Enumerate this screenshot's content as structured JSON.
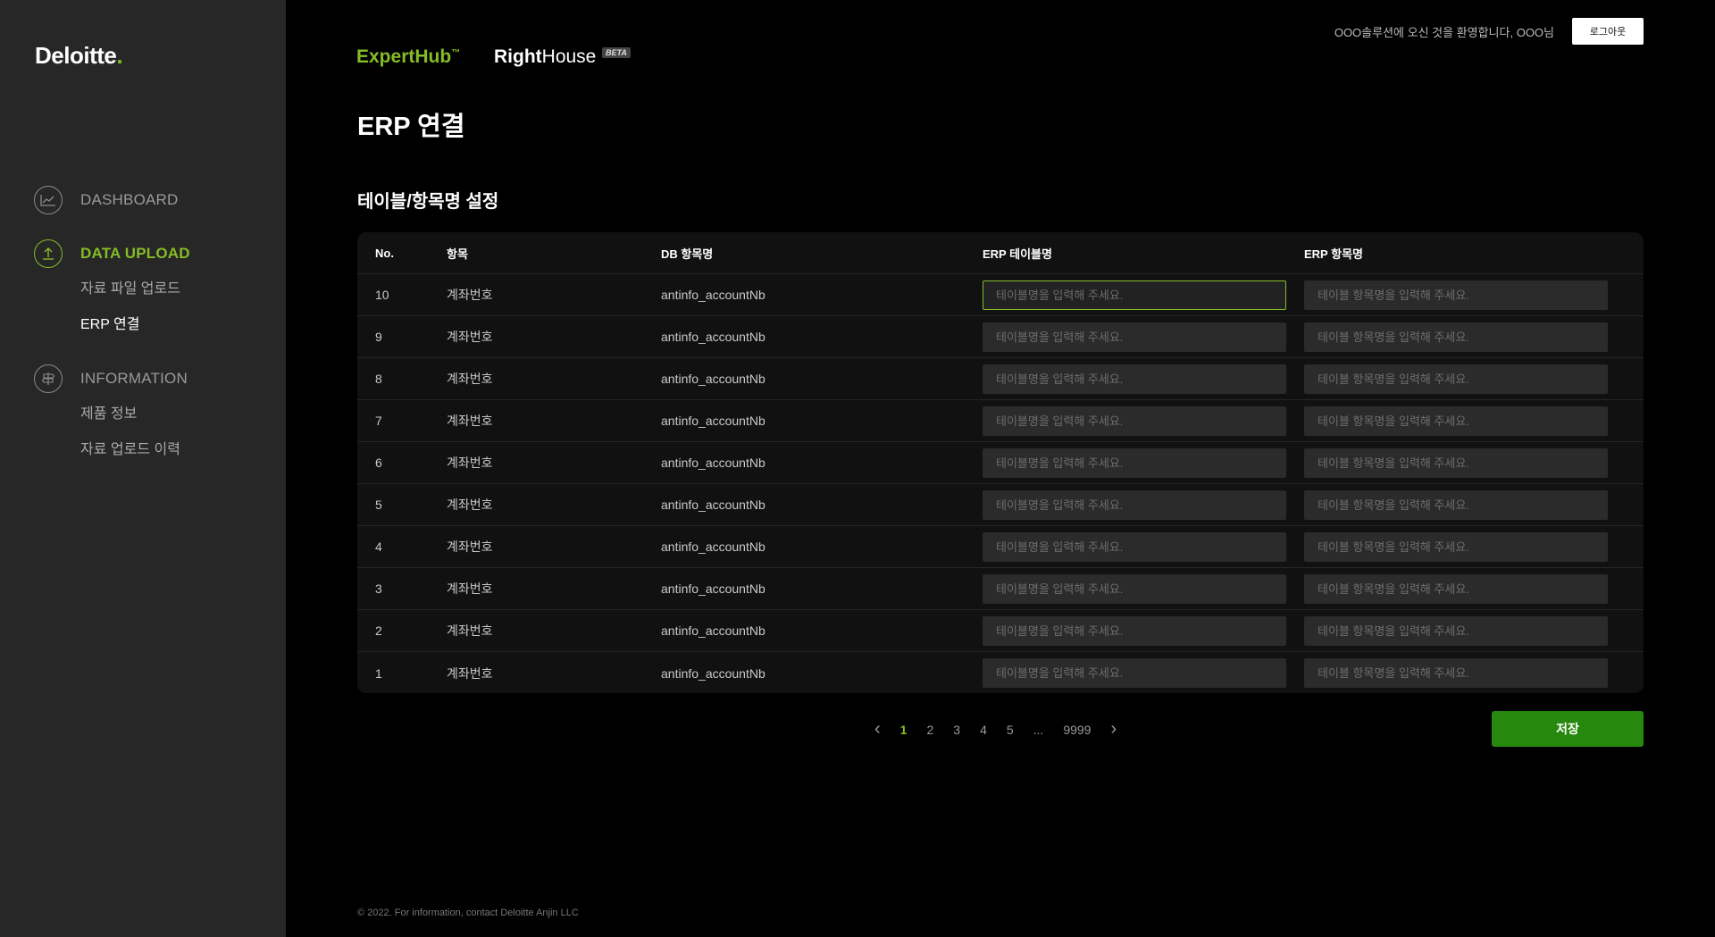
{
  "sidebar": {
    "logo_text": "Deloitte",
    "logo_dot": ".",
    "sections": [
      {
        "label": "DASHBOARD",
        "icon": "chart-line-icon",
        "active": false,
        "items": []
      },
      {
        "label": "DATA UPLOAD",
        "icon": "upload-icon",
        "active": true,
        "items": [
          "자료 파일 업로드",
          "ERP 연결"
        ]
      },
      {
        "label": "INFORMATION",
        "icon": "signpost-icon",
        "active": false,
        "items": [
          "제품 정보",
          "자료 업로드 이력"
        ]
      }
    ]
  },
  "header": {
    "brand1": "ExpertHub",
    "brand1_tm": "™",
    "brand2_bold": "Right",
    "brand2_light": "House",
    "beta": "BETA",
    "welcome": "OOO솔루션에 오신 것을 환영합니다, OOO님",
    "logout": "로그아웃"
  },
  "main": {
    "page_title": "ERP 연결",
    "section_title": "테이블/항목명 설정"
  },
  "table": {
    "headers": [
      "No.",
      "항목",
      "DB 항목명",
      "ERP 테이블명",
      "ERP 항목명"
    ],
    "placeholder_table": "테이블명을 입력해 주세요.",
    "placeholder_item": "테이블 항목명을 입력해 주세요.",
    "rows": [
      {
        "no": "10",
        "item": "계좌번호",
        "db": "antinfo_accountNb"
      },
      {
        "no": "9",
        "item": "계좌번호",
        "db": "antinfo_accountNb"
      },
      {
        "no": "8",
        "item": "계좌번호",
        "db": "antinfo_accountNb"
      },
      {
        "no": "7",
        "item": "계좌번호",
        "db": "antinfo_accountNb"
      },
      {
        "no": "6",
        "item": "계좌번호",
        "db": "antinfo_accountNb"
      },
      {
        "no": "5",
        "item": "계좌번호",
        "db": "antinfo_accountNb"
      },
      {
        "no": "4",
        "item": "계좌번호",
        "db": "antinfo_accountNb"
      },
      {
        "no": "3",
        "item": "계좌번호",
        "db": "antinfo_accountNb"
      },
      {
        "no": "2",
        "item": "계좌번호",
        "db": "antinfo_accountNb"
      },
      {
        "no": "1",
        "item": "계좌번호",
        "db": "antinfo_accountNb"
      }
    ]
  },
  "pagination": {
    "prev": "‹",
    "next": "›",
    "pages": [
      "1",
      "2",
      "3",
      "4",
      "5",
      "...",
      "9999"
    ],
    "current": "1"
  },
  "save_label": "저장",
  "footer": "© 2022. For information, contact Deloitte Anjin LLC",
  "colors": {
    "accent": "#86bc25",
    "save": "#26890d"
  }
}
